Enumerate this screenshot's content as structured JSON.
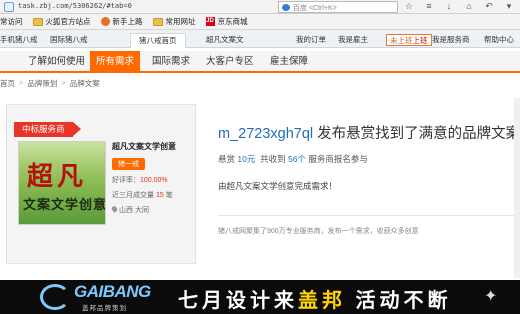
{
  "browser": {
    "url": "task.zbj.com/5306262/#tab=0",
    "search_placeholder": "百度 <Ctrl+K>"
  },
  "bookmarks": [
    {
      "label": "常访问",
      "icon": "none"
    },
    {
      "label": "火狐官方站点",
      "icon": "folder-icon"
    },
    {
      "label": "新手上路",
      "icon": "firefox-icon"
    },
    {
      "label": "常用网址",
      "icon": "folder-icon"
    },
    {
      "label": "京东商城",
      "icon": "jd-icon"
    }
  ],
  "tabs": [
    {
      "label": "手机猪八戒"
    },
    {
      "label": "国际猪八戒"
    },
    {
      "label": "猪八戒首页"
    },
    {
      "label": "超凡文案文"
    },
    {
      "label": "我的订单"
    },
    {
      "label": "我是雇主"
    },
    {
      "label": "未上班",
      "extra": "上班"
    },
    {
      "label": "我是服务商"
    },
    {
      "label": "帮助中心"
    }
  ],
  "nav": {
    "items": [
      "了解如何使用",
      "所有需求",
      "国际需求",
      "大客户专区",
      "雇主保障"
    ],
    "active_index": 1
  },
  "breadcrumb": [
    "首页",
    "品牌策划",
    "品牌文案"
  ],
  "provider": {
    "ribbon": "中标服务商",
    "logo_big": "超凡",
    "logo_small": "文案文学创意",
    "name": "超凡文案文学创意",
    "level_label": "猪一戒",
    "rating_label": "好评率：",
    "rating_value": "100.00%",
    "deals_label": "近三月成交量",
    "deals_value": "15",
    "deals_unit": "笔",
    "location": "山西 大同"
  },
  "task": {
    "user": "m_2723xgh7ql",
    "title_rest": " 发布悬赏找到了满意的品牌文案",
    "bounty_label": "悬赏",
    "bounty_value": "10元",
    "received_label": "共收到",
    "received_value": "56个",
    "received_tail": "服务商报名参与",
    "completed": "由超凡文案文学创意完成需求！",
    "footer_note": "猪八戒网聚集了900万专业服务商，发布一个需求，收获众多创意"
  },
  "banner": {
    "brand": "GAIBANG",
    "brand_sub": "盖邦品牌策划",
    "slogan_pre": "七月设计来",
    "slogan_hl": "盖邦",
    "slogan_post": " 活动不断"
  }
}
